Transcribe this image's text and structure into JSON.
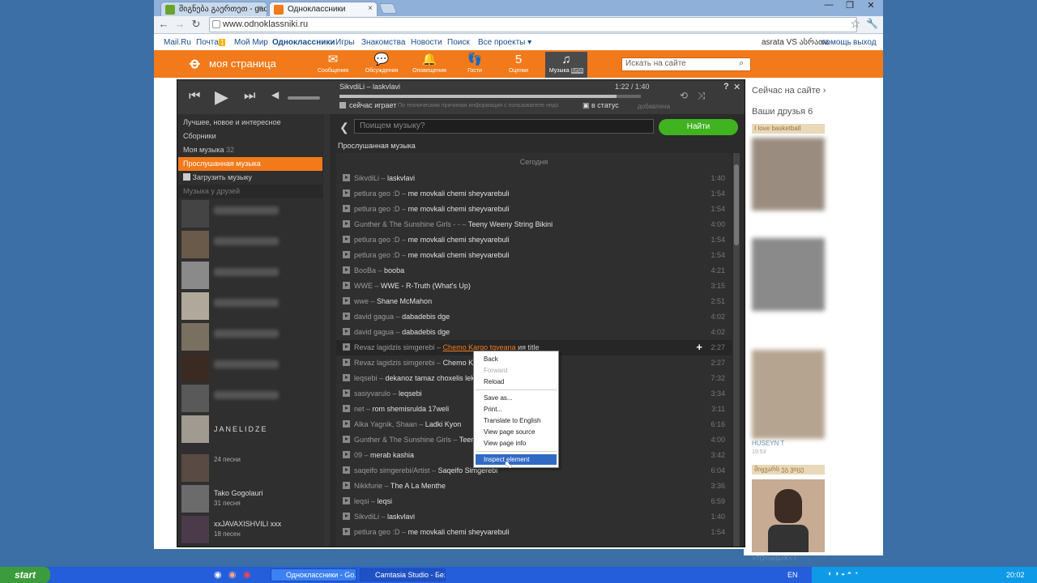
{
  "browser": {
    "tabs": [
      {
        "label": "შიგნება გაერთეთ - gadmot"
      },
      {
        "label": "Одноклассники"
      }
    ],
    "url": "www.odnoklassniki.ru"
  },
  "mailbar": {
    "items": [
      "Mail.Ru",
      "Почта",
      "Мой Мир",
      "Одноклассники",
      "Игры",
      "Знакомства",
      "Новости",
      "Поиск",
      "Все проекты ▾"
    ],
    "mail_badge": "1",
    "user": "asrata VS ასრათა",
    "help": "помощь",
    "logout": "выход"
  },
  "header": {
    "title": "моя страница",
    "search_placeholder": "Искать на сайте",
    "nav": [
      {
        "label": "Сообщения",
        "icon": "envelope-icon",
        "glyph": "✉"
      },
      {
        "label": "Обсуждения",
        "icon": "chat-icon",
        "glyph": "💬"
      },
      {
        "label": "Оповещения",
        "icon": "bell-icon",
        "glyph": "🔔"
      },
      {
        "label": "Гости",
        "icon": "footprints-icon",
        "glyph": "👣"
      },
      {
        "label": "Оценки",
        "icon": "rating-icon",
        "glyph": "5"
      },
      {
        "label": "Музыка",
        "badge": "beta",
        "icon": "music-icon",
        "glyph": "♫"
      }
    ]
  },
  "player": {
    "now_track": "SikvdiLi – laskvlavi",
    "time": "1:22 / 1:40",
    "now_playing": "сейчас играет",
    "info": "По техническим причинам информация с пользователе недо",
    "status_btn": "в статус",
    "added": "добавлена",
    "help": "?",
    "close": "✕",
    "sidebar": [
      {
        "label": "Лучшее, новое и интересное"
      },
      {
        "label": "Сборники"
      },
      {
        "label": "Моя музыка",
        "count": "32"
      },
      {
        "label": "Прослушанная музыка",
        "active": true
      },
      {
        "label": "Загрузить музыку"
      },
      {
        "label": "Музыка у друзей"
      }
    ],
    "friends": [
      {
        "name": "JANELIDZE",
        "count": "24 песни"
      },
      {
        "name": "Tako Gogolauri",
        "count": "31 песня"
      },
      {
        "name": "xxJAVAXISHVILI xxx",
        "count": "18 песен"
      }
    ],
    "search_placeholder": "Поищем музыку?",
    "find_label": "Найти",
    "section_title": "Прослушанная музыка",
    "today": "Сегодня",
    "tracks": [
      {
        "artist": "SikvdiLi",
        "title": "laskvlavi",
        "dur": "1:40"
      },
      {
        "artist": "petlura geo :D",
        "title": "me movkali chemi sheyvarebuli",
        "dur": "1:54"
      },
      {
        "artist": "petlura geo :D",
        "title": "me movkali chemi sheyvarebuli",
        "dur": "1:54"
      },
      {
        "artist": "Gunther & The Sunshine Girls - -",
        "title": "Teeny Weeny String Bikini",
        "dur": "4:00"
      },
      {
        "artist": "petlura geo :D",
        "title": "me movkali chemi sheyvarebuli",
        "dur": "1:54"
      },
      {
        "artist": "petlura geo :D",
        "title": "me movkali chemi sheyvarebuli",
        "dur": "1:54"
      },
      {
        "artist": "BooBa",
        "title": "booba",
        "dur": "4:21"
      },
      {
        "artist": "WWE",
        "title": "WWE - R-Truth (What's Up)",
        "dur": "3:15"
      },
      {
        "artist": "wwe",
        "title": "Shane McMahon",
        "dur": "2:51"
      },
      {
        "artist": "david gagua",
        "title": "dabadebis dge",
        "dur": "4:02"
      },
      {
        "artist": "david gagua",
        "title": "dabadebis dge",
        "dur": "4:02"
      },
      {
        "artist": "Revaz lagidzis simgerebi",
        "title": "Chemo Kargo tqveana",
        "extra": "ия  title",
        "dur": "2:27",
        "hover": true
      },
      {
        "artist": "Revaz lagidzis simgerebi",
        "title": "Chemo Ka",
        "dur": "2:27"
      },
      {
        "artist": "leqsebi",
        "title": "dekanoz tamaz choxelis leks",
        "dur": "7:32"
      },
      {
        "artist": "sasiyvarulo",
        "title": "leqsebi",
        "dur": "3:34"
      },
      {
        "artist": "net",
        "title": "rom shemisrulda 17weli",
        "dur": "3:11"
      },
      {
        "artist": "Alka Yagnik, Shaan",
        "title": "Ladki Kyon",
        "dur": "6:16"
      },
      {
        "artist": "Gunther & The Sunshine Girls",
        "title": "Teem",
        "dur": "4:00"
      },
      {
        "artist": "09",
        "title": "merab kashia",
        "dur": "3:42"
      },
      {
        "artist": "saqeifo simgerebi/Artist",
        "title": "Saqeifo Simgerebi",
        "dur": "6:04"
      },
      {
        "artist": "Nikkfurie",
        "title": "The A La Menthe",
        "dur": "3:36"
      },
      {
        "artist": "leqsi",
        "title": "leqsi",
        "dur": "6:59"
      },
      {
        "artist": "SikvdiLi",
        "title": "laskvlavi",
        "dur": "1:40"
      },
      {
        "artist": "petlura geo :D",
        "title": "me movkali chemi sheyvarebuli",
        "dur": "1:54"
      }
    ]
  },
  "context_menu": {
    "items": [
      {
        "label": "Back"
      },
      {
        "label": "Forward",
        "disabled": true
      },
      {
        "label": "Reload"
      },
      {
        "label": "Save as..."
      },
      {
        "label": "Print..."
      },
      {
        "label": "Translate to English"
      },
      {
        "label": "View page source"
      },
      {
        "label": "View page info"
      },
      {
        "label": "Inspect element",
        "selected": true
      }
    ]
  },
  "rightcol": {
    "now_on_site": "Сейчас на сайте ›",
    "friends": "Ваши друзья 6",
    "tag1": "I love basketball",
    "friend1": "HUSEYN T",
    "friend1_time": "19:53",
    "tag2": "მიყვარს ეგ ვიცე",
    "friend2": ">TO<nets>K< i"
  },
  "taskbar": {
    "start": "start",
    "windows": [
      "Одноклассники - Go...",
      "Camtasia Studio - Без..."
    ],
    "lang": "EN",
    "clock": "20:02"
  }
}
